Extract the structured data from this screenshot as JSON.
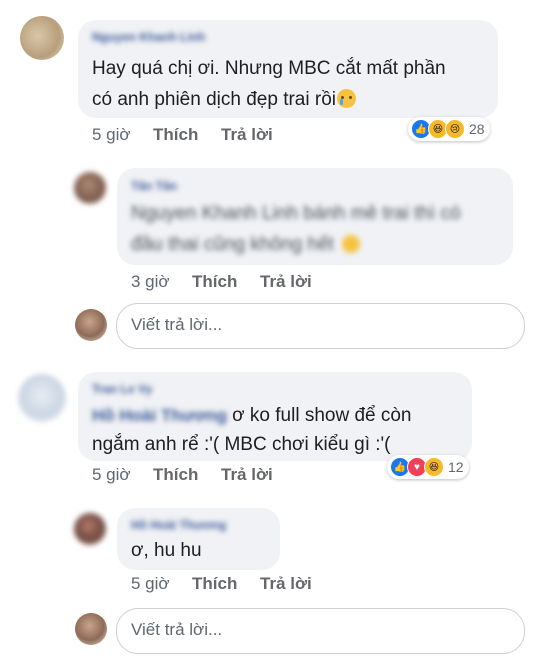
{
  "comments": [
    {
      "author": "Nguyen Khanh Linh",
      "line1": "Hay quá chị ơi. Nhưng MBC cắt mất phần",
      "line2": "có anh phiên dịch đẹp trai rồi",
      "time": "5 giờ",
      "like": "Thích",
      "reply": "Trả lời",
      "reactions": [
        "like",
        "haha",
        "sad"
      ],
      "reaction_count": "28"
    },
    {
      "author": "Tân Tân",
      "line1": "Nguyen Khanh Linh bánh mê trai thì có",
      "line2": "đầu thai cũng không hết",
      "time": "3 giờ",
      "like": "Thích",
      "reply": "Trả lời"
    },
    {
      "author": "Tran Le Vy",
      "mention": "Hồ Hoài Thương",
      "line1_rest": " ơ ko full show để còn",
      "line2": "ngắm anh rể :'( MBC chơi kiểu gì :'(",
      "time": "5 giờ",
      "like": "Thích",
      "reply": "Trả lời",
      "reactions": [
        "like",
        "love",
        "haha"
      ],
      "reaction_count": "12"
    },
    {
      "author": "Hồ Hoài Thương",
      "line1": "ơ, hu hu",
      "time": "5 giờ",
      "like": "Thích",
      "reply": "Trả lời"
    }
  ],
  "reply_inputs": [
    {
      "placeholder": "Viết trả lời..."
    },
    {
      "placeholder": "Viết trả lời..."
    }
  ],
  "colors": {
    "bubble": "#f0f2f5",
    "name": "#385898",
    "like": "#1877f2",
    "love": "#f33e58",
    "haha": "#f7b928"
  }
}
